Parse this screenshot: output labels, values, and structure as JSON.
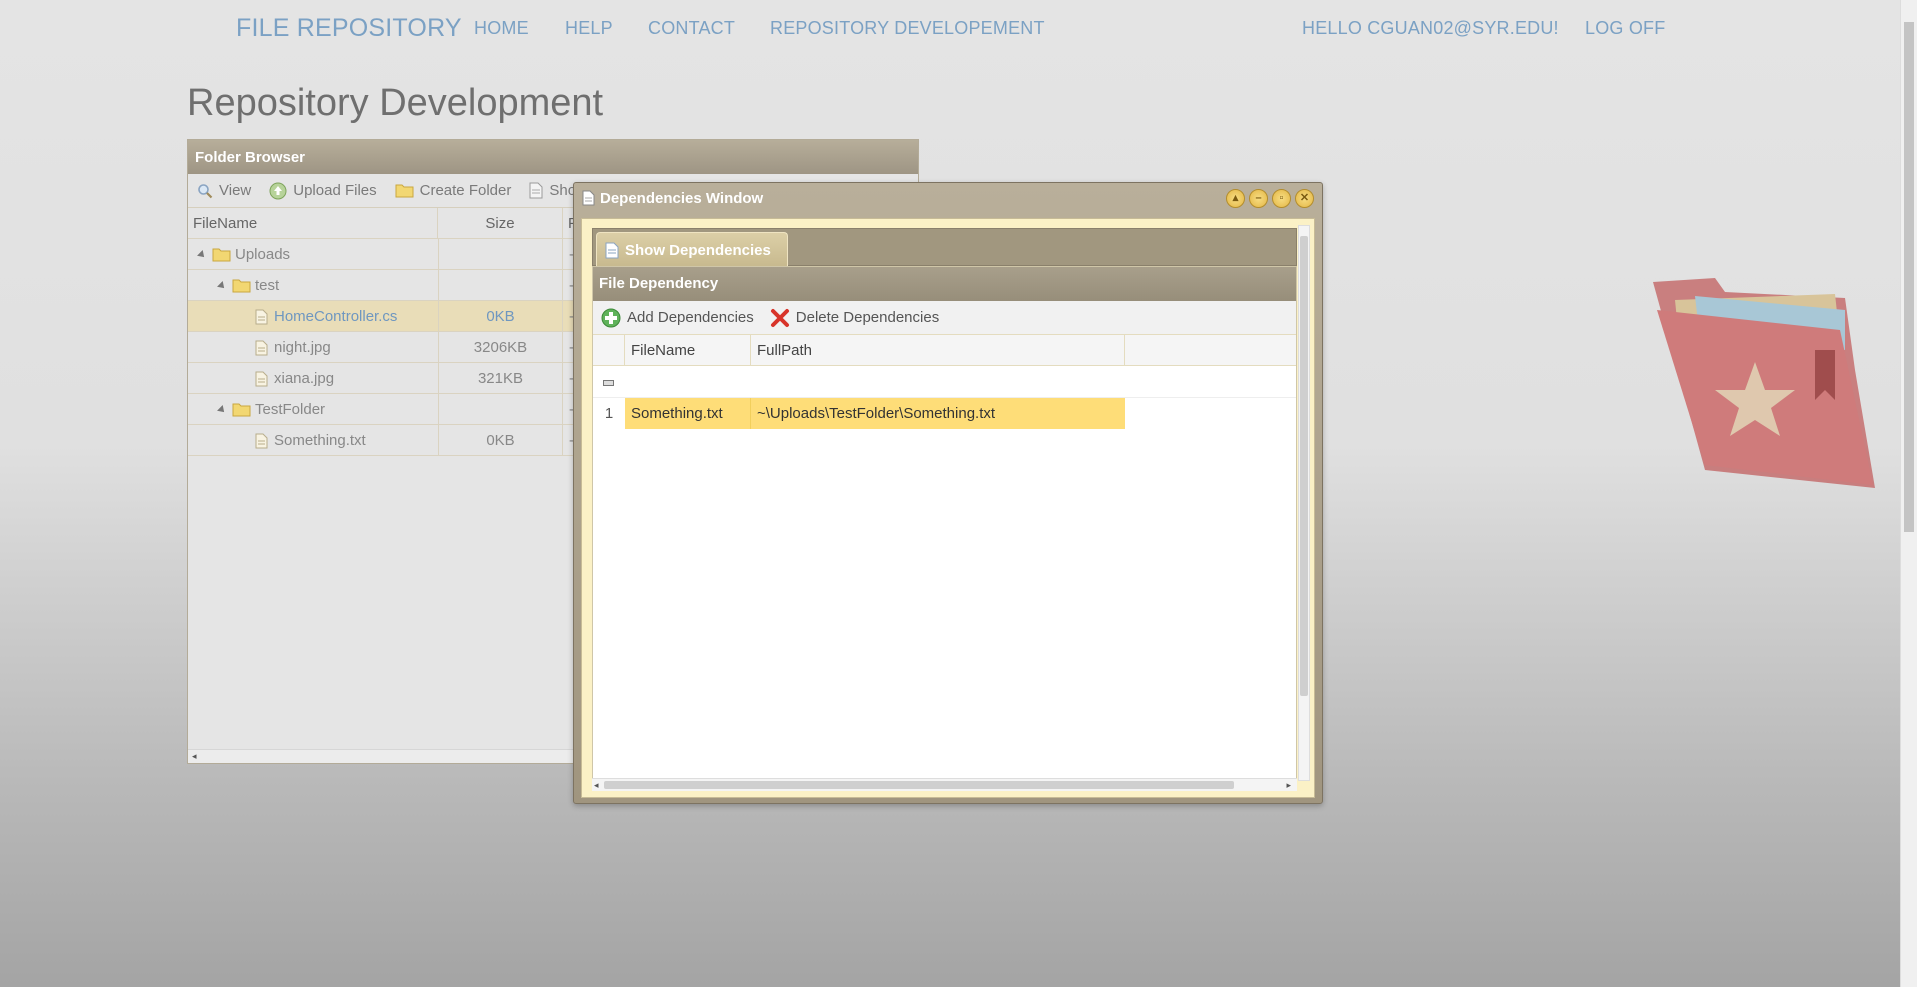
{
  "nav": {
    "brand": "FILE REPOSITORY",
    "home": "HOME",
    "help": "HELP",
    "contact": "CONTACT",
    "repo_dev": "REPOSITORY DEVELOPEMENT",
    "hello": "HELLO CGUAN02@SYR.EDU!",
    "logoff": "LOG OFF"
  },
  "page": {
    "title": "Repository Development"
  },
  "folder_browser": {
    "title": "Folder Browser",
    "toolbar": {
      "view": "View",
      "upload": "Upload Files",
      "create_folder": "Create Folder",
      "show": "Sho"
    },
    "columns": {
      "filename": "FileName",
      "size": "Size",
      "extra": "F"
    },
    "rows": [
      {
        "name": "Uploads",
        "size": "",
        "type": "folder"
      },
      {
        "name": "test",
        "size": "",
        "type": "folder"
      },
      {
        "name": "HomeController.cs",
        "size": "0KB",
        "type": "file",
        "selected": true
      },
      {
        "name": "night.jpg",
        "size": "3206KB",
        "type": "file"
      },
      {
        "name": "xiana.jpg",
        "size": "321KB",
        "type": "file"
      },
      {
        "name": "TestFolder",
        "size": "",
        "type": "folder"
      },
      {
        "name": "Something.txt",
        "size": "0KB",
        "type": "file"
      }
    ]
  },
  "dependencies_window": {
    "title": "Dependencies Window",
    "tab": "Show Dependencies",
    "section_title": "File Dependency",
    "toolbar": {
      "add": "Add Dependencies",
      "delete": "Delete Dependencies"
    },
    "columns": {
      "filename": "FileName",
      "fullpath": "FullPath"
    },
    "rows": [
      {
        "num": "1",
        "filename": "Something.txt",
        "fullpath": "~\\Uploads\\TestFolder\\Something.txt"
      }
    ]
  },
  "colors": {
    "accent_link": "#7ba1c4",
    "selected_row": "#fedd78",
    "window_chrome": "#a0957f"
  }
}
